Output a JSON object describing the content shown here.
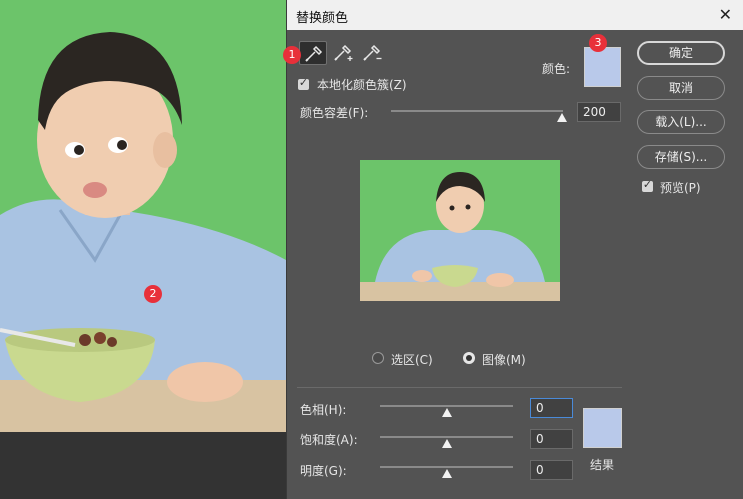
{
  "dialog": {
    "title": "替换颜色",
    "close_label": "✕"
  },
  "badges": [
    "1",
    "2",
    "3"
  ],
  "localized_clusters": {
    "label": "本地化颜色簇(Z)",
    "checked": true
  },
  "color_label": "颜色:",
  "tolerance": {
    "label": "颜色容差(F):",
    "value": "200"
  },
  "selection_mode": {
    "selection_label": "选区(C)",
    "image_label": "图像(M)",
    "selected": "image"
  },
  "buttons": {
    "ok": "确定",
    "cancel": "取消",
    "load": "载入(L)...",
    "save": "存储(S)..."
  },
  "preview": {
    "label": "预览(P)",
    "checked": true
  },
  "hue": {
    "label": "色相(H):",
    "value": "0"
  },
  "saturation": {
    "label": "饱和度(A):",
    "value": "0"
  },
  "lightness": {
    "label": "明度(G):",
    "value": "0"
  },
  "result_label": "结果",
  "colors": {
    "swatch": "#b9c9ea",
    "green_screen": "#6cc46a",
    "badge": "#e8303a"
  },
  "icons": [
    "eyedropper-icon",
    "eyedropper-plus-icon",
    "eyedropper-minus-icon",
    "checkbox-check-icon",
    "close-icon",
    "slider-thumb-icon"
  ]
}
